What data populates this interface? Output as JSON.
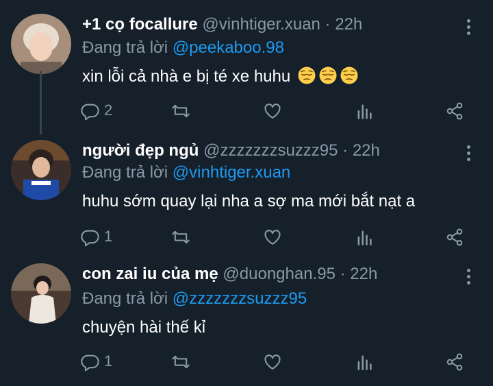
{
  "reply_label": "Đang trả lời",
  "tweets": [
    {
      "name": "+1 cọ focallure",
      "handle": "@vinhtiger.xuan",
      "time": "22h",
      "replying_to": "@peekaboo.98",
      "text": "xin lỗi cả nhà e bị té xe huhu",
      "emoji": [
        "pensive-face-emoji",
        "pensive-face-emoji",
        "pensive-face-emoji"
      ],
      "reply_count": "2",
      "retweet_count": "",
      "like_count": ""
    },
    {
      "name": "người đẹp ngủ",
      "handle": "@zzzzzzzsuzzz95",
      "time": "22h",
      "replying_to": "@vinhtiger.xuan",
      "text": "huhu sớm quay lại nha a sợ ma mới bắt nạt a",
      "reply_count": "1",
      "retweet_count": "",
      "like_count": ""
    },
    {
      "name": "con zai iu của mẹ",
      "handle": "@duonghan.95",
      "time": "22h",
      "replying_to": "@zzzzzzzsuzzz95",
      "text": "chuyện hài thế kỉ",
      "reply_count": "1",
      "retweet_count": "",
      "like_count": ""
    }
  ],
  "colors": {
    "background": "#15202b",
    "muted": "#8b98a5",
    "link": "#1d9bf0",
    "line": "#38444d"
  }
}
